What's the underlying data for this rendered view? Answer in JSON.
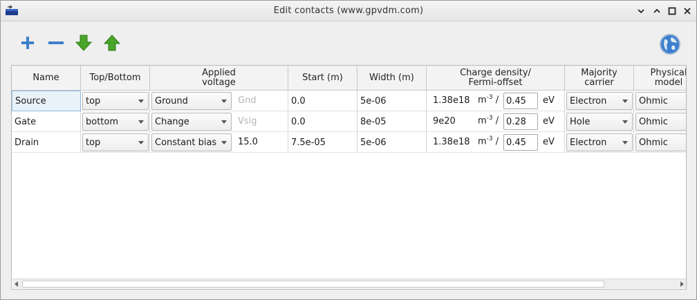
{
  "window": {
    "title": "Edit contacts (www.gpvdm.com)"
  },
  "icons": {
    "app": "app-window-icon",
    "add": "plus-icon",
    "remove": "minus-icon",
    "move_down": "arrow-down-icon",
    "move_up": "arrow-up-icon",
    "help": "globe-icon"
  },
  "table": {
    "headers": [
      "Name",
      "Top/Bottom",
      "Applied\nvoltage",
      "Start (m)",
      "Width (m)",
      "Charge density/\nFermi-offset",
      "Majority\ncarrier",
      "Physical\nmodel"
    ],
    "rows": [
      {
        "name": "Source",
        "position": "top",
        "voltage_type": "Ground",
        "voltage_value": "Gnd",
        "start": "0.0",
        "width": "5e-06",
        "charge_density": "1.38e18",
        "density_unit": "m",
        "density_exp": "-3",
        "slash": "/",
        "fermi_offset": "0.45",
        "fermi_unit": "eV",
        "carrier": "Electron",
        "model": "Ohmic"
      },
      {
        "name": "Gate",
        "position": "bottom",
        "voltage_type": "Change",
        "voltage_value": "Vsig",
        "start": "0.0",
        "width": "8e-05",
        "charge_density": "9e20",
        "density_unit": "m",
        "density_exp": "-3",
        "slash": "/",
        "fermi_offset": "0.28",
        "fermi_unit": "eV",
        "carrier": "Hole",
        "model": "Ohmic"
      },
      {
        "name": "Drain",
        "position": "top",
        "voltage_type": "Constant bias",
        "voltage_value": "15.0",
        "start": "7.5e-05",
        "width": "5e-06",
        "charge_density": "1.38e18",
        "density_unit": "m",
        "density_exp": "-3",
        "slash": "/",
        "fermi_offset": "0.45",
        "fermi_unit": "eV",
        "carrier": "Electron",
        "model": "Ohmic"
      }
    ]
  },
  "colors": {
    "add_icon": "#3d7fc8",
    "remove_icon": "#3d7fc8",
    "arrow_icons": "#4aa52a",
    "selection": "#eaf2f9"
  }
}
